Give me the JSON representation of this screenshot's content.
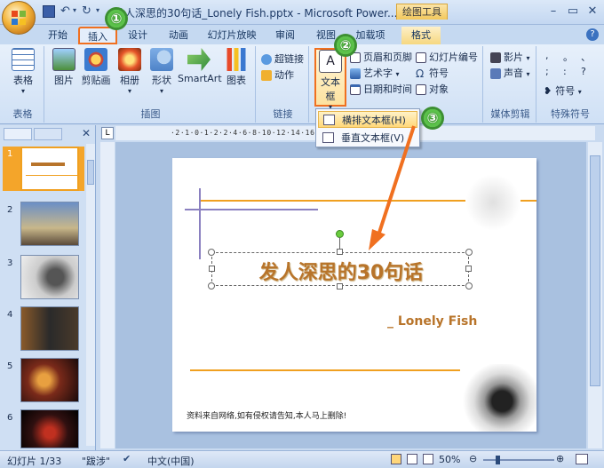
{
  "window": {
    "title": "发人深思的30句话_Lonely Fish.pptx - Microsoft Power...",
    "tools_tab": "绘图工具",
    "controls": [
      "–",
      "▭",
      "✕"
    ]
  },
  "ribbon_tabs": [
    "开始",
    "插入",
    "设计",
    "动画",
    "幻灯片放映",
    "审阅",
    "视图",
    "加载项",
    "格式"
  ],
  "groups": {
    "table": {
      "label": "表格",
      "btn": "表格"
    },
    "illustrations": {
      "label": "插图",
      "btns": [
        "图片",
        "剪贴画",
        "相册",
        "形状",
        "SmartArt",
        "图表"
      ]
    },
    "links": {
      "label": "链接",
      "btns": [
        "超链接",
        "动作"
      ]
    },
    "text": {
      "textbox_btn": "文本框",
      "small": [
        "页眉和页脚",
        "艺术字",
        "日期和时间",
        "幻灯片编号",
        "符号",
        "对象"
      ]
    },
    "media": {
      "label": "媒体剪辑",
      "btns": [
        "影片",
        "声音"
      ]
    },
    "special": {
      "label": "特殊符号",
      "btn": "符号",
      "glyphs": [
        ",",
        "。",
        "、",
        ";",
        ":",
        "?"
      ]
    }
  },
  "dropdown": {
    "items": [
      "横排文本框(H)",
      "垂直文本框(V)"
    ]
  },
  "markers": [
    "①",
    "②",
    "③"
  ],
  "ruler_text": "·2·1·0·1·2·2·4·6·8·10·12·14·16·18·20·22",
  "slide_numbers": [
    "1",
    "2",
    "3",
    "4",
    "5",
    "6"
  ],
  "slide": {
    "title": "发人深思的30句话",
    "author": "_ Lonely Fish",
    "footer": "资料来自网络,如有侵权请告知,本人马上删除!"
  },
  "status": {
    "slide_info": "幻灯片 1/33",
    "theme": "\"跋涉\"",
    "language": "中文(中国)",
    "zoom": "50%"
  },
  "colors": {
    "accent_orange": "#f0a020",
    "title_text": "#b8742a",
    "arrow": "#f07020",
    "marker": "#4caf3a"
  }
}
